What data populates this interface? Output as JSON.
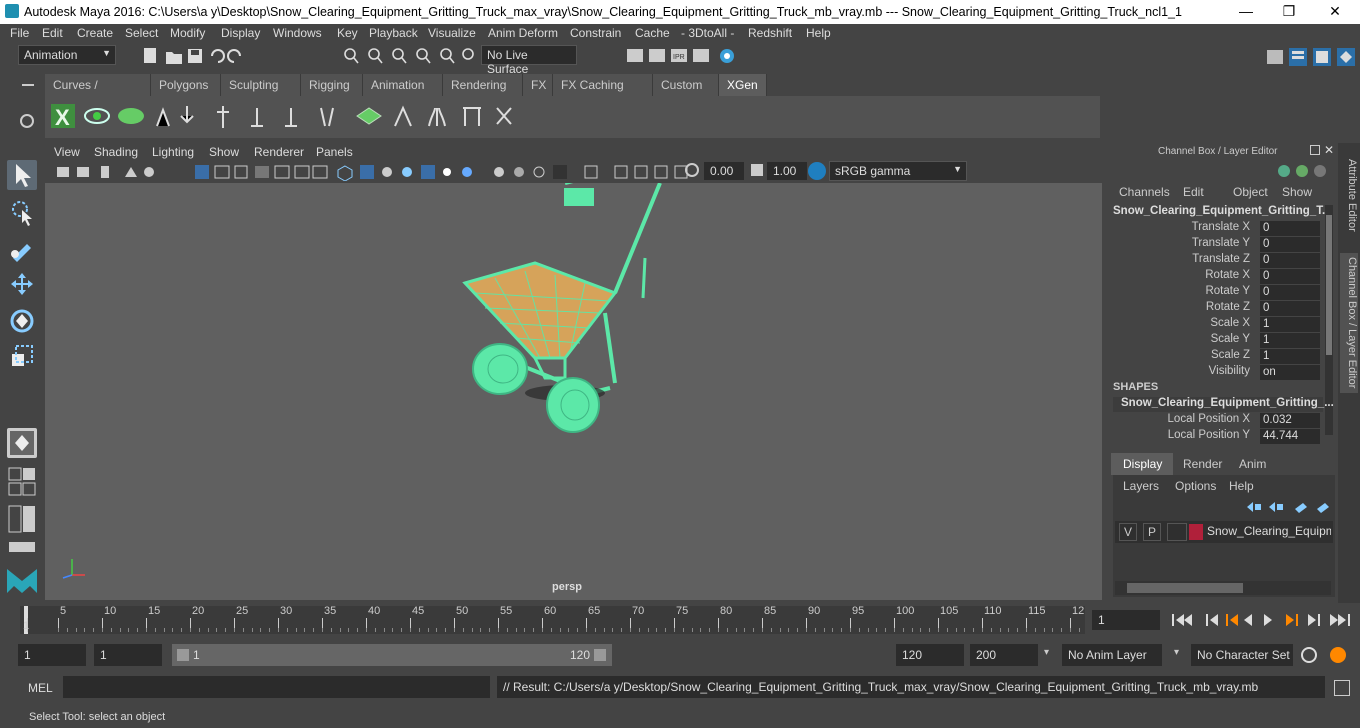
{
  "window": {
    "title": "Autodesk Maya 2016: C:\\Users\\a y\\Desktop\\Snow_Clearing_Equipment_Gritting_Truck_max_vray\\Snow_Clearing_Equipment_Gritting_Truck_mb_vray.mb   ---   Snow_Clearing_Equipment_Gritting_Truck_ncl1_1",
    "minimize": "—",
    "maximize": "❐",
    "close": "✕"
  },
  "menubar": [
    "File",
    "Edit",
    "Create",
    "Select",
    "Modify",
    "Display",
    "Windows",
    "Key",
    "Playback",
    "Visualize",
    "Anim Deform",
    "Constrain",
    "Cache",
    "- 3DtoAll -",
    "Redshift",
    "Help"
  ],
  "statusline": {
    "mode": "Animation",
    "live_surface": "No Live Surface"
  },
  "shelf_tabs": [
    "Curves / Surfaces",
    "Polygons",
    "Sculpting",
    "Rigging",
    "Animation",
    "Rendering",
    "FX",
    "FX Caching",
    "Custom",
    "XGen"
  ],
  "shelf_active": "XGen",
  "viewport": {
    "menu": [
      "View",
      "Shading",
      "Lighting",
      "Show",
      "Renderer",
      "Panels"
    ],
    "exposure": "0.00",
    "gamma": "1.00",
    "color_space": "sRGB gamma",
    "camera_label": "persp"
  },
  "channel_box": {
    "header": "Channel Box / Layer Editor",
    "menu": [
      "Channels",
      "Edit",
      "Object",
      "Show"
    ],
    "object_name": "Snow_Clearing_Equipment_Gritting_T...",
    "attributes": [
      {
        "label": "Translate X",
        "value": "0"
      },
      {
        "label": "Translate Y",
        "value": "0"
      },
      {
        "label": "Translate Z",
        "value": "0"
      },
      {
        "label": "Rotate X",
        "value": "0"
      },
      {
        "label": "Rotate Y",
        "value": "0"
      },
      {
        "label": "Rotate Z",
        "value": "0"
      },
      {
        "label": "Scale X",
        "value": "1"
      },
      {
        "label": "Scale Y",
        "value": "1"
      },
      {
        "label": "Scale Z",
        "value": "1"
      },
      {
        "label": "Visibility",
        "value": "on"
      }
    ],
    "shapes_header": "SHAPES",
    "shape_name": "Snow_Clearing_Equipment_Gritting_...",
    "shape_attributes": [
      {
        "label": "Local Position X",
        "value": "0.032"
      },
      {
        "label": "Local Position Y",
        "value": "44.744"
      }
    ]
  },
  "layer_editor": {
    "tabs": [
      "Display",
      "Render",
      "Anim"
    ],
    "active_tab": "Display",
    "menu": [
      "Layers",
      "Options",
      "Help"
    ],
    "layer": {
      "v": "V",
      "p": "P",
      "name": "Snow_Clearing_Equipme",
      "color": "#b0203a"
    }
  },
  "side_tabs": [
    "Attribute Editor",
    "Channel Box / Layer Editor"
  ],
  "timeline": {
    "ticks": [
      "1",
      "5",
      "10",
      "15",
      "20",
      "25",
      "30",
      "35",
      "40",
      "45",
      "50",
      "55",
      "60",
      "65",
      "70",
      "75",
      "80",
      "85",
      "90",
      "95",
      "100",
      "105",
      "110",
      "115",
      "12"
    ],
    "current_frame": "1"
  },
  "range": {
    "start": "1",
    "playback_start": "1",
    "slider_start": "1",
    "slider_end": "120",
    "playback_end": "120",
    "end": "200",
    "anim_layer": "No Anim Layer",
    "char_set": "No Character Set"
  },
  "cmd": {
    "label": "MEL",
    "result": "// Result: C:/Users/a y/Desktop/Snow_Clearing_Equipment_Gritting_Truck_max_vray/Snow_Clearing_Equipment_Gritting_Truck_mb_vray.mb"
  },
  "help_line": "Select Tool: select an object",
  "colors": {
    "accent": "#4ad7a0",
    "model": "#5ce8a8",
    "selected_tab": "#5d5d5d"
  }
}
